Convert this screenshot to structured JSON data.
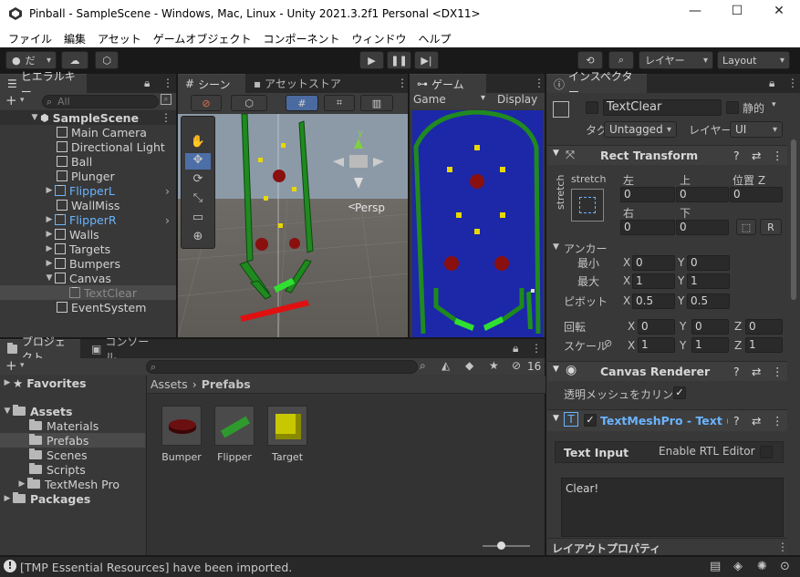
{
  "window": {
    "title": "Pinball - SampleScene - Windows, Mac, Linux - Unity 2021.3.2f1 Personal <DX11>",
    "controls": [
      "—",
      "☐",
      "✕"
    ]
  },
  "menu": [
    "ファイル",
    "編集",
    "アセット",
    "ゲームオブジェクト",
    "コンポーネント",
    "ウィンドウ",
    "ヘルプ"
  ],
  "toolbar": {
    "account": "だ",
    "layers": "レイヤー",
    "layout": "Layout"
  },
  "hierarchy": {
    "tab": "ヒエラルキー",
    "search_placeholder": "All",
    "scene": "SampleScene",
    "items": [
      {
        "label": "Main Camera"
      },
      {
        "label": "Directional Light"
      },
      {
        "label": "Ball"
      },
      {
        "label": "Plunger"
      },
      {
        "label": "FlipperL"
      },
      {
        "label": "WallMiss"
      },
      {
        "label": "FlipperR"
      },
      {
        "label": "Walls"
      },
      {
        "label": "Targets"
      },
      {
        "label": "Bumpers"
      },
      {
        "label": "Canvas"
      },
      {
        "label": "TextClear"
      },
      {
        "label": "EventSystem"
      }
    ]
  },
  "scene_tabs": {
    "scene": "シーン",
    "asset_store": "アセットストア",
    "game": "ゲーム",
    "persp": "Persp",
    "game_dropdown": "Game",
    "display": "Display"
  },
  "project": {
    "tab_project": "プロジェクト",
    "tab_console": "コンソール",
    "hidden_count": "16",
    "favorites": "Favorites",
    "assets": "Assets",
    "folders": [
      "Materials",
      "Prefabs",
      "Scenes",
      "Scripts",
      "TextMesh Pro"
    ],
    "packages": "Packages",
    "breadcrumb_root": "Assets",
    "breadcrumb_sep": "›",
    "breadcrumb_current": "Prefabs",
    "prefabs": [
      {
        "label": "Bumper",
        "color": "#6b1010"
      },
      {
        "label": "Flipper",
        "color": "#2e9a2e"
      },
      {
        "label": "Target",
        "color": "#c8c800"
      }
    ]
  },
  "inspector": {
    "tab": "インスペクター",
    "object_name": "TextClear",
    "static_label": "静的",
    "tag_label": "タグ",
    "tag_value": "Untagged",
    "layer_label": "レイヤー",
    "layer_value": "UI",
    "rect_transform": "Rect Transform",
    "stretch": "stretch",
    "left_label": "左",
    "top_label": "上",
    "posz_label": "位置 Z",
    "left_value": "0",
    "top_value": "0",
    "posz_value": "0",
    "right_label": "右",
    "bottom_label": "下",
    "right_value": "0",
    "bottom_value": "0",
    "r_button": "R",
    "anchors": "アンカー",
    "min_label": "最小",
    "max_label": "最大",
    "pivot_label": "ピボット",
    "anchor_min": {
      "x": "0",
      "y": "0"
    },
    "anchor_max": {
      "x": "1",
      "y": "1"
    },
    "pivot": {
      "x": "0.5",
      "y": "0.5"
    },
    "rotation_label": "回転",
    "rotation": {
      "x": "0",
      "y": "0",
      "z": "0"
    },
    "scale_label": "スケール",
    "scale": {
      "x": "1",
      "y": "1",
      "z": "1"
    },
    "canvas_renderer": "Canvas Renderer",
    "cull_transparent": "透明メッシュをカリング",
    "tmp_component": "TextMeshPro - Text (U",
    "text_input": "Text Input",
    "enable_rtl": "Enable RTL Editor",
    "text_value": "Clear!",
    "layout_properties": "レイアウトプロパティ",
    "axis_x": "X",
    "axis_y": "Y",
    "axis_z": "Z"
  },
  "status": {
    "message": "[TMP Essential Resources] have been imported."
  },
  "colors": {
    "accent_blue": "#6ab4ff",
    "game_bg": "#1c28a8",
    "wall_green": "#1e8a1e"
  }
}
